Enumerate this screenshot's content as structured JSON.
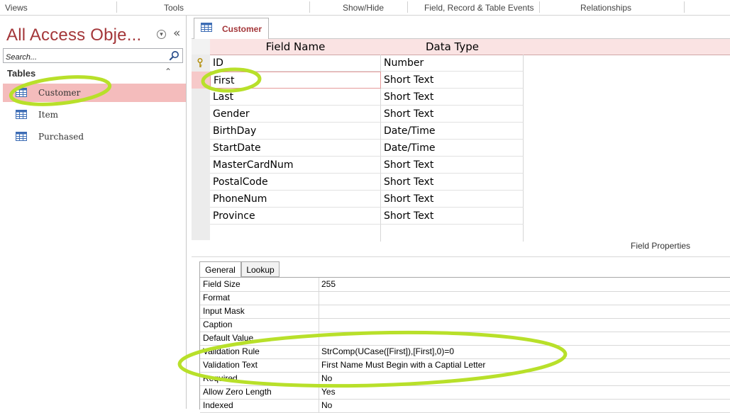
{
  "ribbon": {
    "groups": [
      "Views",
      "Tools",
      "Show/Hide",
      "Field, Record & Table Events",
      "Relationships"
    ]
  },
  "nav_pane": {
    "title": "All Access Obje...",
    "search_placeholder": "Search...",
    "group_label": "Tables",
    "items": [
      {
        "label": "Customer",
        "selected": true
      },
      {
        "label": "Item",
        "selected": false
      },
      {
        "label": "Purchased",
        "selected": false
      }
    ]
  },
  "document_tab": {
    "label": "Customer"
  },
  "design_grid": {
    "headers": [
      "Field Name",
      "Data Type"
    ],
    "rows": [
      {
        "field": "ID",
        "type": "Number",
        "primary_key": true
      },
      {
        "field": "First",
        "type": "Short Text",
        "active": true
      },
      {
        "field": "Last",
        "type": "Short Text"
      },
      {
        "field": "Gender",
        "type": "Short Text"
      },
      {
        "field": "BirthDay",
        "type": "Date/Time"
      },
      {
        "field": "StartDate",
        "type": "Date/Time"
      },
      {
        "field": "MasterCardNum",
        "type": "Short Text"
      },
      {
        "field": "PostalCode",
        "type": "Short Text"
      },
      {
        "field": "PhoneNum",
        "type": "Short Text"
      },
      {
        "field": "Province",
        "type": "Short Text"
      }
    ]
  },
  "field_properties": {
    "caption": "Field Properties",
    "tabs": [
      "General",
      "Lookup"
    ],
    "rows": [
      {
        "name": "Field Size",
        "value": "255"
      },
      {
        "name": "Format",
        "value": ""
      },
      {
        "name": "Input Mask",
        "value": ""
      },
      {
        "name": "Caption",
        "value": ""
      },
      {
        "name": "Default Value",
        "value": ""
      },
      {
        "name": "Validation Rule",
        "value": "StrComp(UCase([First]),[First],0)=0"
      },
      {
        "name": "Validation Text",
        "value": "First Name Must Begin with a Captial Letter"
      },
      {
        "name": "Required",
        "value": "No"
      },
      {
        "name": "Allow Zero Length",
        "value": "Yes"
      },
      {
        "name": "Indexed",
        "value": "No"
      }
    ]
  },
  "colors": {
    "title_red": "#a4373a",
    "selection_pink": "#f4bcbc",
    "header_pink": "#fae3e3",
    "highlight_green": "#b8e02a"
  },
  "icons": [
    "search-icon",
    "table-icon",
    "key-icon",
    "chevron-down-icon",
    "collapse-icon"
  ]
}
